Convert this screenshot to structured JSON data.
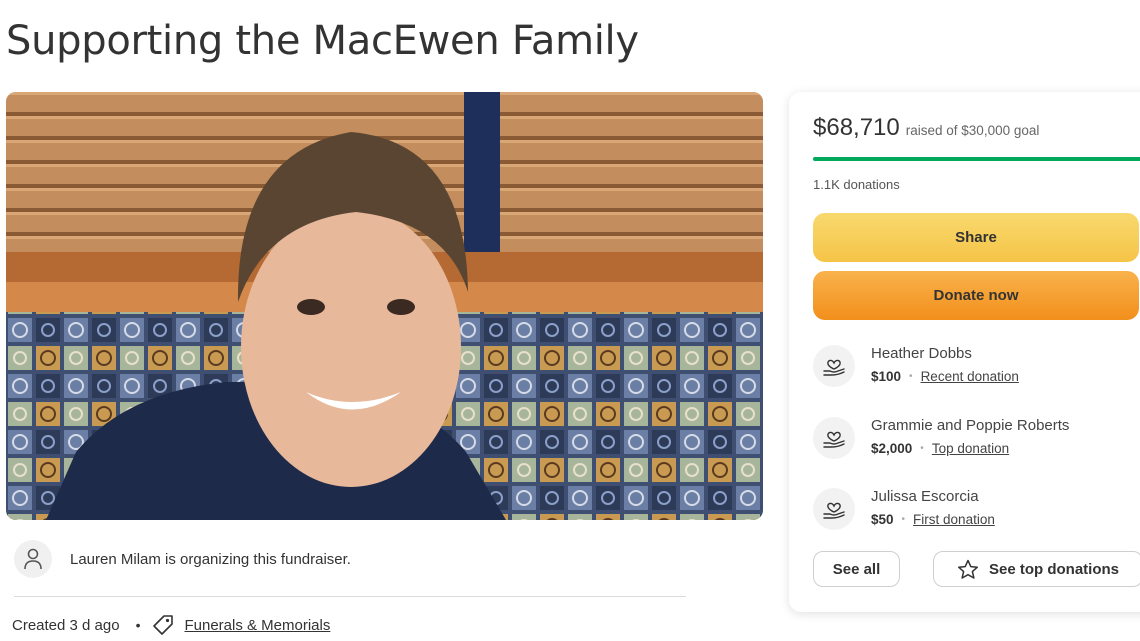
{
  "page": {
    "title": "Supporting the MacEwen Family"
  },
  "organizer": {
    "text": "Lauren Milam is organizing this fundraiser."
  },
  "meta": {
    "created": "Created 3 d ago",
    "bullet": "•",
    "category": "Funerals & Memorials"
  },
  "card": {
    "raised_amount": "$68,710",
    "goal_text": "raised of $30,000 goal",
    "progress_fraction": 1.0,
    "donations_count": "1.1K donations",
    "share_label": "Share",
    "donate_label": "Donate now",
    "see_all_label": "See all",
    "see_top_label": "See top donations",
    "donors": [
      {
        "name": "Heather Dobbs",
        "amount": "$100",
        "kind": "Recent donation"
      },
      {
        "name": "Grammie and Poppie Roberts",
        "amount": "$2,000",
        "kind": "Top donation"
      },
      {
        "name": "Julissa Escorcia",
        "amount": "$50",
        "kind": "First donation"
      }
    ],
    "separator": "•"
  },
  "colors": {
    "progress": "#02a95c",
    "share_button": "#f5c447",
    "donate_button": "#f28f1c"
  },
  "icons": {
    "organizer": "person-icon",
    "category": "tag-icon",
    "donor": "heart-hand-icon",
    "top_donations": "star-icon"
  }
}
